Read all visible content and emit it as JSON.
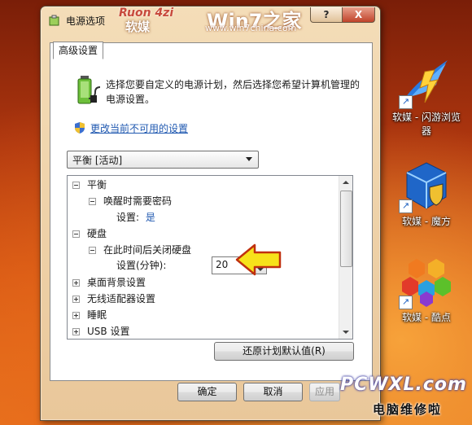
{
  "window": {
    "title": "电源选项",
    "help_button": "?",
    "close_button": "X",
    "tab_label": "高级设置",
    "intro_text": "选择您要自定义的电源计划，然后选择您希望计算机管理的电源设置。",
    "change_link": "更改当前不可用的设置",
    "plan_select": "平衡 [活动]",
    "restore_button": "还原计划默认值(R)",
    "ok_button": "确定",
    "cancel_button": "取消",
    "apply_button": "应用"
  },
  "brand_overlay": {
    "ruon": "Ruon 4zi",
    "ruanmei": "软媒",
    "win7": "Win7之家",
    "site": "www.win7china.com"
  },
  "tree": {
    "balance": "平衡",
    "wake_password": "唤醒时需要密码",
    "setting_label": "设置:",
    "setting_value": "是",
    "hard_disk": "硬盘",
    "turn_off_disk": "在此时间后关闭硬盘",
    "minutes_label": "设置(分钟):",
    "minutes_value": "20",
    "desktop_bg": "桌面背景设置",
    "wireless": "无线适配器设置",
    "sleep": "睡眠",
    "usb": "USB 设置"
  },
  "desktop": {
    "icons": [
      {
        "label": "软媒 - 闪游浏览器",
        "icon": "flash-browser-icon"
      },
      {
        "label": "软媒 - 魔方",
        "icon": "cube-icon"
      },
      {
        "label": "软媒 - 酷点",
        "icon": "hexagon-icon"
      }
    ],
    "watermark_pc": "PCWXL.com",
    "watermark_cn": "电脑维修啦"
  }
}
